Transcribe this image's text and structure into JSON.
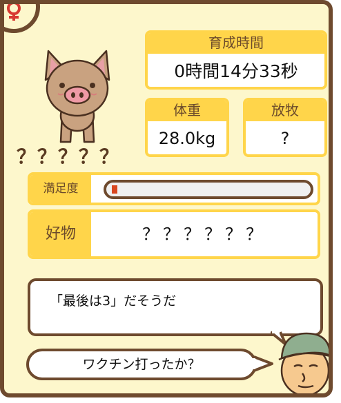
{
  "pig": {
    "name": "？？？？？",
    "icon": "pig-icon"
  },
  "badge": {
    "icon": "female-symbol-icon"
  },
  "growth_time": {
    "label": "育成時間",
    "value": "0時間14分33秒"
  },
  "weight": {
    "label": "体重",
    "value": "28.0kg"
  },
  "grazing": {
    "label": "放牧",
    "value": "?"
  },
  "satisfaction": {
    "label": "満足度",
    "level": 0.03,
    "fill_color": "#d9461f"
  },
  "favorite": {
    "label": "好物",
    "value": "？？？？？？"
  },
  "dialogue": {
    "hint": "「最後は3」だそうだ",
    "farmer_line": "ワクチン打ったか？",
    "speaker_icon": "farmer-avatar-icon"
  },
  "colors": {
    "frame": "#6e4a2e",
    "panel": "#fdf7cc",
    "accent": "#ffd54a",
    "label_text": "#6b4a2b"
  }
}
